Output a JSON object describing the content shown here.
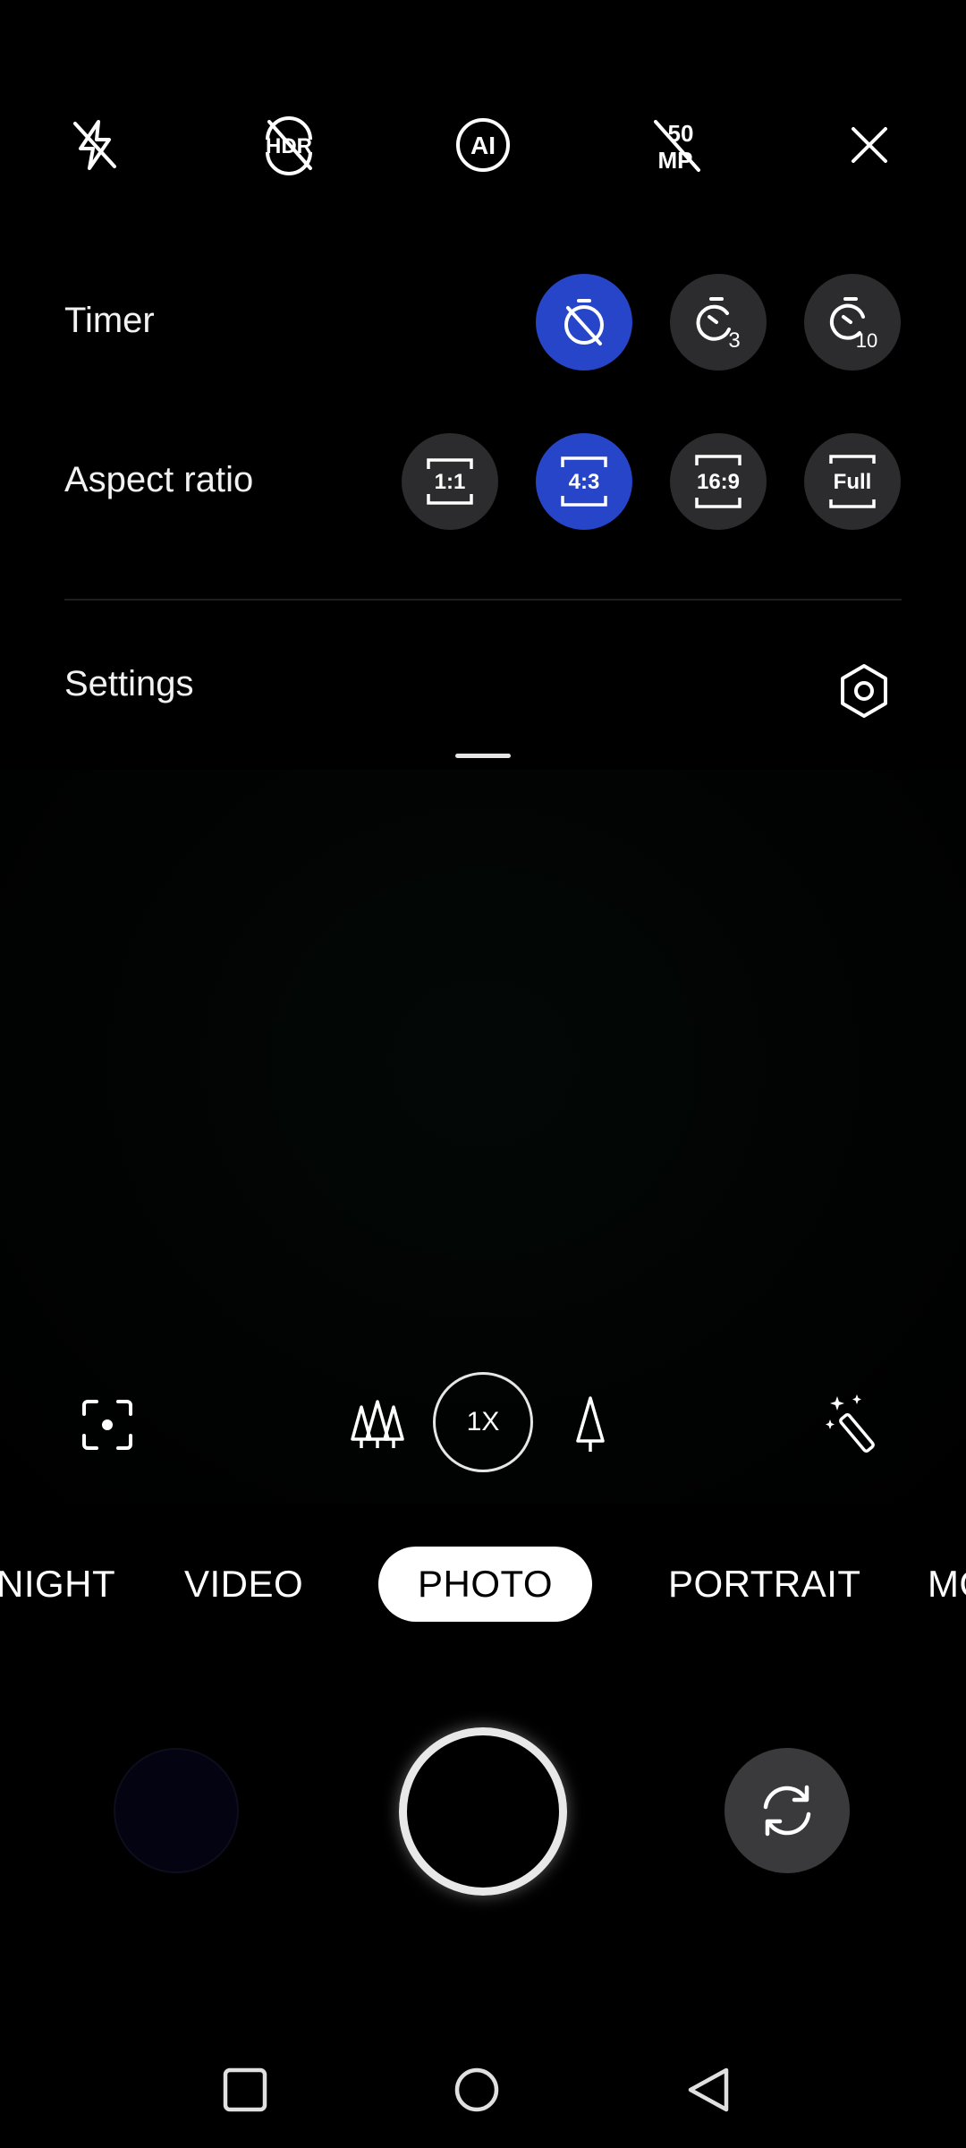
{
  "top_bar": {
    "icons": [
      "flash-off-icon",
      "hdr-off-icon",
      "ai-icon",
      "50mp-off-icon",
      "close-icon"
    ],
    "hdr_text": "HDR",
    "ai_text": "AI",
    "mp_text_top": "50",
    "mp_text_bottom": "MP"
  },
  "timer": {
    "label": "Timer",
    "options": [
      {
        "name": "timer-off",
        "text": "",
        "active": true
      },
      {
        "name": "timer-3s",
        "text": "3",
        "active": false
      },
      {
        "name": "timer-10s",
        "text": "10",
        "active": false
      }
    ]
  },
  "aspect_ratio": {
    "label": "Aspect ratio",
    "options": [
      {
        "text": "1:1",
        "active": false
      },
      {
        "text": "4:3",
        "active": true
      },
      {
        "text": "16:9",
        "active": false
      },
      {
        "text": "Full",
        "active": false
      }
    ]
  },
  "settings": {
    "label": "Settings"
  },
  "zoom": {
    "current": "1X"
  },
  "modes": {
    "items": [
      "NIGHT",
      "VIDEO",
      "PHOTO",
      "PORTRAIT",
      "MO"
    ],
    "selected": "PHOTO"
  },
  "colors": {
    "accent": "#2645c9",
    "button_bg": "#2c2c2e",
    "background": "#000000"
  }
}
